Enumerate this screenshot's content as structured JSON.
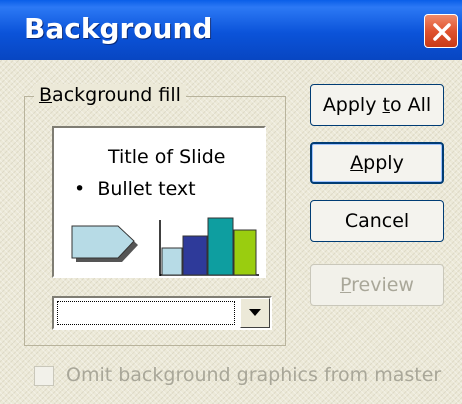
{
  "window": {
    "title": "Background"
  },
  "group": {
    "legend": "Background fill",
    "legend_access_key": "B",
    "legend_rest": "ackground fill"
  },
  "preview": {
    "slide_title": "Title of Slide",
    "bullet_text": "Bullet text",
    "bullet_marker": "•",
    "colors": {
      "arrow_fill": "#b7dbe6",
      "bar1": "#b7dbe6",
      "bar2": "#2e3a9a",
      "bar3": "#0e9ea0",
      "bar4": "#9acd0f"
    }
  },
  "fill_dropdown": {
    "value": ""
  },
  "buttons": {
    "apply_to_all": {
      "label": "Apply to All",
      "pre": "Apply ",
      "key": "t",
      "post": "o All"
    },
    "apply": {
      "label": "Apply",
      "pre": "",
      "key": "A",
      "post": "pply"
    },
    "cancel": {
      "label": "Cancel"
    },
    "preview": {
      "label": "Preview",
      "pre": "",
      "key": "P",
      "post": "review",
      "enabled": false
    }
  },
  "omit_checkbox": {
    "label": "Omit background graphics from master",
    "pre": "Omit background ",
    "key": "g",
    "post": "raphics from master",
    "checked": false,
    "enabled": false
  },
  "colors": {
    "title_bar": "#0b53d9",
    "close_button": "#e0532f",
    "dialog_face": "#ece9d8",
    "disabled_text": "#a9a799"
  }
}
